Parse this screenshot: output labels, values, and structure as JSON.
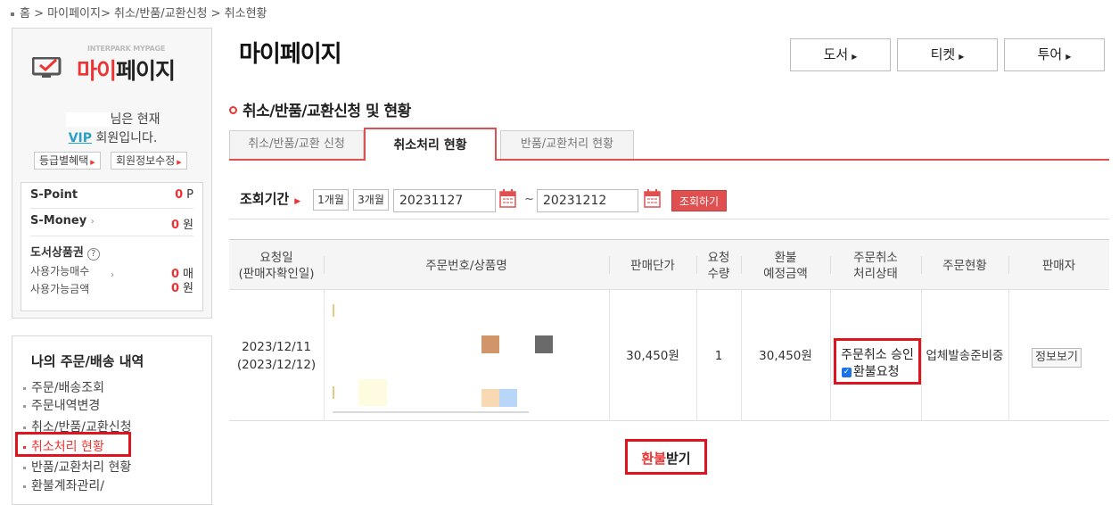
{
  "breadcrumb": {
    "home": "홈",
    "sep": ">",
    "mypage": "마이페이지",
    "cancel_apply": "취소/반품/교환신청",
    "current": "취소현황"
  },
  "sidebar": {
    "logo_small": "INTERPARK MYPAGE",
    "logo_red": "마이",
    "logo_dark": "페이지",
    "user_suffix": "님은 현재",
    "grade": "VIP",
    "grade_suffix": "회원입니다.",
    "benefit_btn": "등급별혜택",
    "edit_btn": "회원정보수정",
    "spoint_label": "S-Point",
    "spoint_value": "0",
    "spoint_unit": "P",
    "smoney_label": "S-Money",
    "smoney_value": "0",
    "smoney_unit": "원",
    "voucher_label": "도서상품권",
    "voucher_q": "?",
    "voucher_count_label": "사용가능매수",
    "voucher_count_value": "0",
    "voucher_count_unit": "매",
    "voucher_amount_label": "사용가능금액",
    "voucher_amount_value": "0",
    "voucher_amount_unit": "원",
    "menu_title": "나의 주문/배송 내역",
    "menu_items": [
      "주문/배송조회",
      "주문내역변경",
      "취소/반품/교환신청",
      "취소처리 현황",
      "반품/교환처리 현황",
      "환불계좌관리/"
    ]
  },
  "main": {
    "title": "마이페이지",
    "top_buttons": [
      "도서",
      "티켓",
      "투어"
    ],
    "section_title": "취소/반품/교환신청 및 현황",
    "tabs": [
      "취소/반품/교환 신청",
      "취소처리 현황",
      "반품/교환처리 현황"
    ],
    "search": {
      "label": "조회기간",
      "period_1m": "1개월",
      "period_3m": "3개월",
      "start_date": "20231127",
      "tilde": "~",
      "end_date": "20231212",
      "search_btn": "조회하기"
    },
    "table": {
      "headers": {
        "request_date": "요청일",
        "request_date_sub": "(판매자확인일)",
        "order": "주문번호/상품명",
        "price": "판매단가",
        "qty": "요청",
        "qty_sub": "수량",
        "refund": "환불",
        "refund_sub": "예정금액",
        "cancel_status": "주문취소",
        "cancel_status_sub": "처리상태",
        "order_status": "주문현황",
        "seller": "판매자"
      },
      "row": {
        "date": "2023/12/11",
        "date_sub": "(2023/12/12)",
        "price": "30,450원",
        "qty": "1",
        "refund": "30,450원",
        "status": "주문취소 승인",
        "refund_request": "환불요청",
        "order_status": "업체발송준비중",
        "seller_btn": "정보보기"
      }
    },
    "refund_button_red": "환불",
    "refund_button_dark": "받기"
  },
  "colors": {
    "accent": "#e05050",
    "highlight_box": "#e0141e",
    "vip": "#2aa0c8"
  }
}
